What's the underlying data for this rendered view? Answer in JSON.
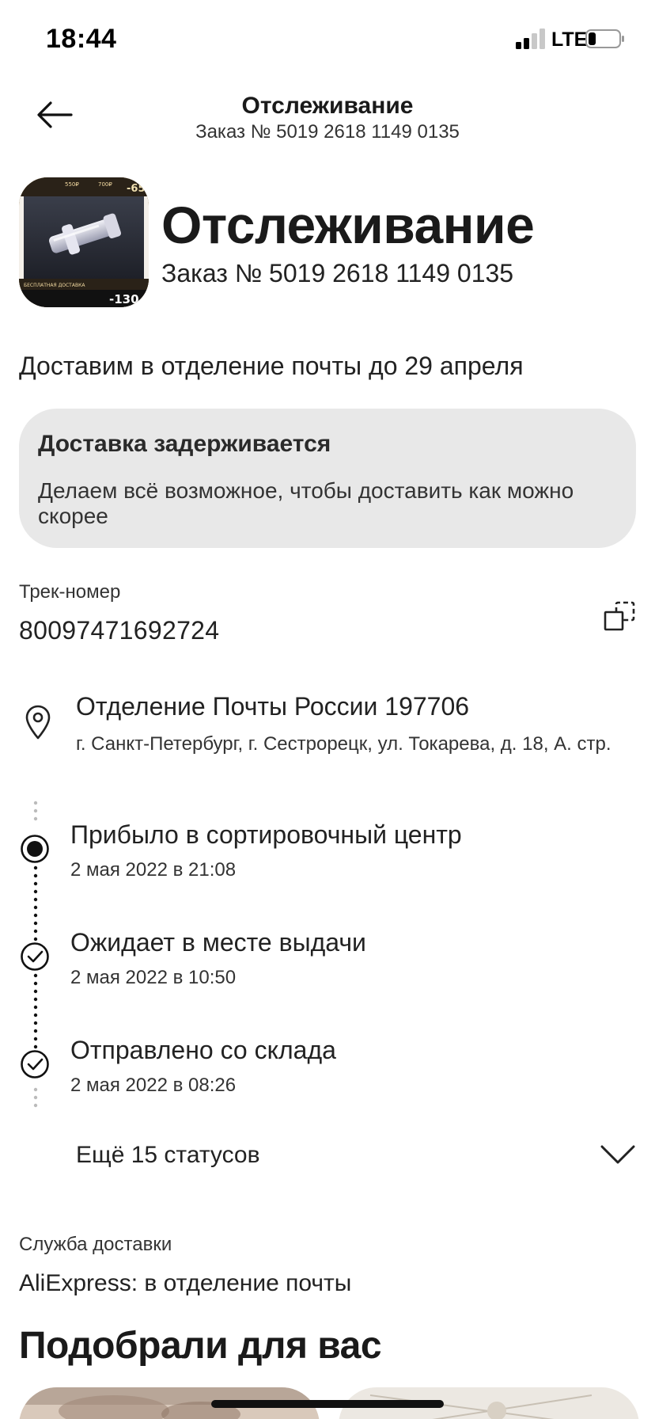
{
  "status_bar": {
    "time": "18:44",
    "network": "LTE"
  },
  "header": {
    "title": "Отслеживание",
    "subtitle": "Заказ № 5019 2618 1149 0135",
    "back_icon": "arrow-left-icon"
  },
  "hero": {
    "title": "Отслеживание",
    "subtitle": "Заказ № 5019 2618 1149 0135"
  },
  "product_image": {
    "price_tags": [
      "550₽",
      "700₽",
      "-65"
    ],
    "badge": "-130",
    "banner": "БЕСПЛАТНАЯ ДОСТАВКА"
  },
  "eta_text": "Доставим в отделение почты до 29 апреля",
  "delay_card": {
    "title": "Доставка задерживается",
    "text": "Делаем всё возможное, чтобы доставить как можно скорее"
  },
  "tracking": {
    "label": "Трек-номер",
    "number": "80097471692724",
    "copy_icon": "copy-icon"
  },
  "pickup": {
    "icon": "location-pin-icon",
    "name": "Отделение Почты России 197706",
    "address": "г. Санкт-Петербург, г. Сестрорецк, ул. Токарева, д. 18, А. стр."
  },
  "timeline": [
    {
      "title": "Прибыло в сортировочный центр",
      "time": "2 мая 2022 в 21:08",
      "state": "current"
    },
    {
      "title": "Ожидает в месте выдачи",
      "time": "2 мая 2022 в 10:50",
      "state": "done"
    },
    {
      "title": "Отправлено со склада",
      "time": "2 мая 2022 в 08:26",
      "state": "done"
    }
  ],
  "more_statuses": {
    "label": "Ещё 15 статусов",
    "icon": "chevron-down-icon"
  },
  "delivery_service": {
    "label": "Служба доставки",
    "value": "AliExpress: в отделение почты"
  },
  "recommendations": {
    "title": "Подобрали для вас"
  },
  "colors": {
    "text": "#1a1a1a",
    "card_bg": "#e8e8e8",
    "background": "#ffffff"
  }
}
